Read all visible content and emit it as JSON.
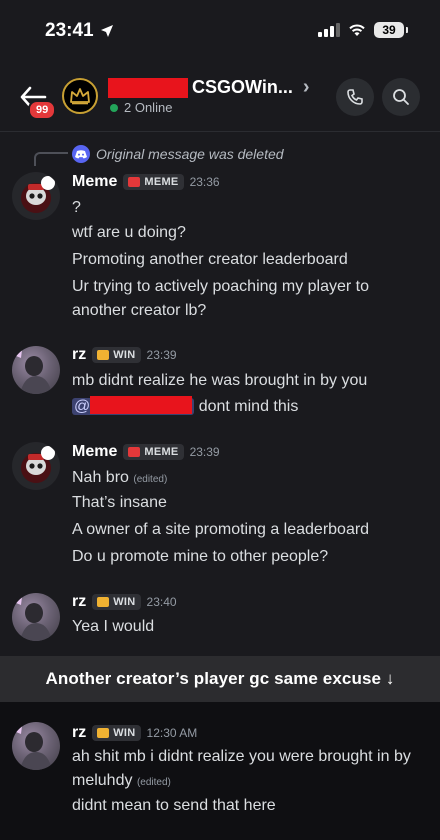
{
  "status_bar": {
    "time": "23:41",
    "battery": "39"
  },
  "header": {
    "title": "CSGOWin...",
    "online": "2 Online",
    "notif_count": "99"
  },
  "reply": {
    "text": "Original message was deleted"
  },
  "messages": [
    {
      "user": "Meme",
      "tag": "MEME",
      "time": "23:36",
      "lines": [
        "?",
        "wtf are u doing?",
        "Promoting another creator leaderboard",
        "Ur trying to actively poaching my player to",
        "another creator lb?"
      ]
    },
    {
      "user": "rz",
      "tag": "WIN",
      "time": "23:39",
      "lines": [
        "mb didnt realize he was brought in by you",
        "dont mind this"
      ],
      "mention_prefix": "@"
    },
    {
      "user": "Meme",
      "tag": "MEME",
      "time": "23:39",
      "lines": [
        "Nah bro",
        "That’s insane",
        "A owner of a site promoting a leaderboard",
        "Do u promote mine to other people?"
      ],
      "edited": "(edited)"
    },
    {
      "user": "rz",
      "tag": "WIN",
      "time": "23:40",
      "lines": [
        "Yea I would"
      ]
    },
    {
      "user": "rz",
      "tag": "WIN",
      "time": "12:30 AM",
      "lines": [
        "ah shit mb i didnt realize you were brought in by",
        "meluhdy",
        "didnt mean to send that here"
      ],
      "edited": "(edited)"
    }
  ],
  "caption": "Another creator’s player gc same excuse ↓",
  "colors": {
    "meme_tag": "#e3383a",
    "win_tag": "#f0b232",
    "online": "#23a55a",
    "redaction": "#e8141c"
  },
  "icons": [
    "location-arrow-icon",
    "signal-icon",
    "wifi-icon",
    "battery-icon",
    "back-arrow-icon",
    "crown-icon",
    "chevron-right-icon",
    "phone-icon",
    "search-icon",
    "discord-icon"
  ]
}
